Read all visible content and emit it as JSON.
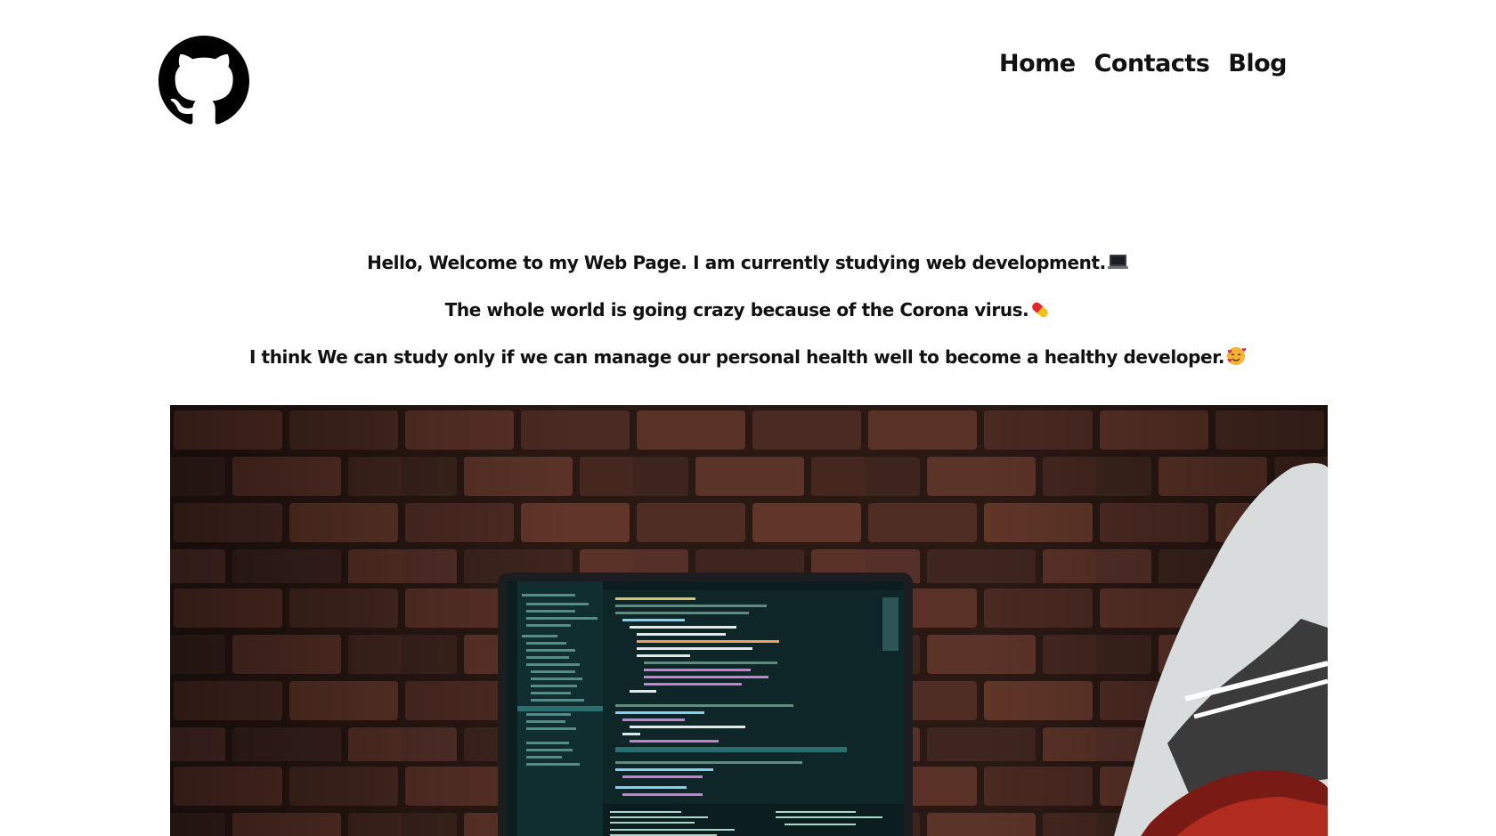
{
  "header": {
    "logo_icon": "github-icon",
    "nav": {
      "home": "Home",
      "contacts": "Contacts",
      "blog": "Blog"
    }
  },
  "intro": {
    "line1": "Hello, Welcome to my Web Page. I am currently studying web development.",
    "line1_icon": "laptop-emoji-icon",
    "line2": "The whole world is going crazy because of the Corona virus.",
    "line2_icon": "pill-emoji-icon",
    "line3": "I think We can study only if we can manage our personal health well to become a healthy developer.",
    "line3_icon": "smiling-face-with-hearts-emoji-icon"
  },
  "hero_image": {
    "subject": "laptop-with-code-editor-on-brick-wall-photo"
  },
  "colors": {
    "text": "#111111",
    "background": "#ffffff",
    "brick": "#4a2a22",
    "editor": "#1e3a3c",
    "code_accent": "#4fd1c5"
  }
}
